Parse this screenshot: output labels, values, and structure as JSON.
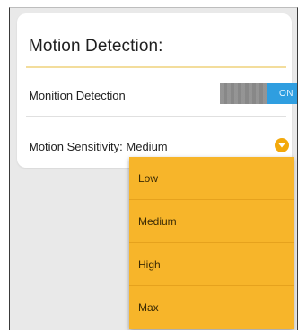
{
  "section": {
    "title": "Motion Detection:"
  },
  "motion_detection": {
    "label": "Monition Detection",
    "toggle_state": "ON"
  },
  "sensitivity": {
    "label": "Motion Sensitivity:",
    "value": "Medium",
    "dropdown_icon": "chevron-down-icon",
    "options": [
      "Low",
      "Medium",
      "High",
      "Max"
    ]
  },
  "colors": {
    "accent": "#f3a90c",
    "menu_bg": "#f7b52a",
    "toggle_on": "#2f9ee0",
    "toggle_off": "#8e8e8e",
    "divider": "#f3dd9c"
  }
}
